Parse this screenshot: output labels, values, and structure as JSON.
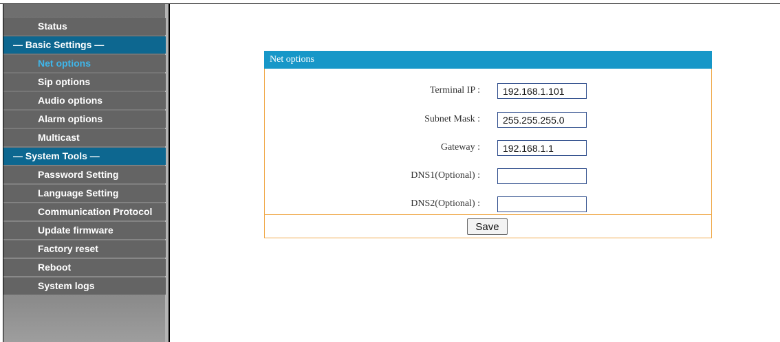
{
  "sidebar": {
    "items": [
      {
        "type": "item",
        "label": "Status"
      },
      {
        "type": "header",
        "label": "— Basic Settings —"
      },
      {
        "type": "item",
        "label": "Net options",
        "active": true
      },
      {
        "type": "item",
        "label": "Sip options"
      },
      {
        "type": "item",
        "label": "Audio options"
      },
      {
        "type": "item",
        "label": "Alarm options"
      },
      {
        "type": "item",
        "label": "Multicast"
      },
      {
        "type": "header",
        "label": "— System Tools —"
      },
      {
        "type": "item",
        "label": "Password Setting"
      },
      {
        "type": "item",
        "label": "Language Setting"
      },
      {
        "type": "item",
        "label": "Communication Protocol"
      },
      {
        "type": "item",
        "label": "Update firmware"
      },
      {
        "type": "item",
        "label": "Factory reset"
      },
      {
        "type": "item",
        "label": "Reboot"
      },
      {
        "type": "item",
        "label": "System logs"
      }
    ]
  },
  "panel": {
    "title": "Net options",
    "fields": [
      {
        "label": "Terminal IP :",
        "value": "192.168.1.101"
      },
      {
        "label": "Subnet Mask :",
        "value": "255.255.255.0"
      },
      {
        "label": "Gateway :",
        "value": "192.168.1.1"
      },
      {
        "label": "DNS1(Optional) :",
        "value": ""
      },
      {
        "label": "DNS2(Optional) :",
        "value": ""
      }
    ],
    "save_label": "Save"
  },
  "colors": {
    "menu_item_bg": "#646464",
    "menu_header_bg": "#0d6790",
    "active_text": "#3fb6ea",
    "panel_header_bg": "#1797c8",
    "panel_border": "#f0a94a"
  }
}
